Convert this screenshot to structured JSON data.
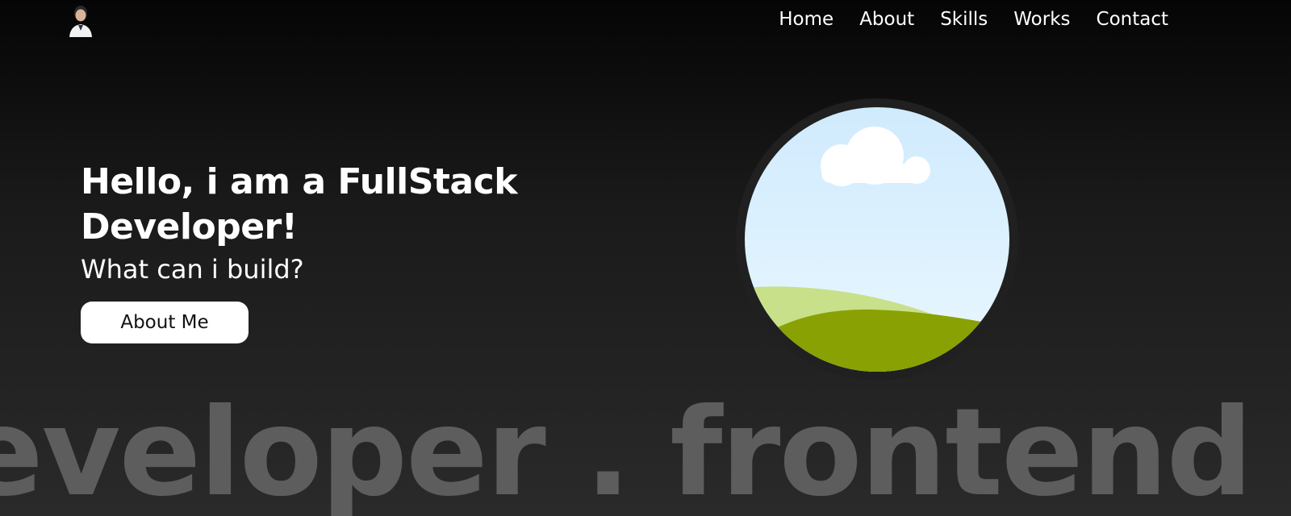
{
  "header": {
    "avatar_icon": "profile-avatar",
    "nav": [
      {
        "label": "Home"
      },
      {
        "label": "About"
      },
      {
        "label": "Skills"
      },
      {
        "label": "Works"
      },
      {
        "label": "Contact"
      }
    ]
  },
  "hero": {
    "title": "Hello, i am a FullStack Developer!",
    "subtitle": "What can i build?",
    "button_label": "About Me",
    "image_icon": "landscape-illustration"
  },
  "marquee": {
    "text": "eveloper . frontend . d"
  },
  "colors": {
    "background_top": "#050505",
    "background_bottom": "#2a2a2a",
    "text": "#ffffff",
    "button_bg": "#ffffff",
    "button_text": "#111111",
    "marquee_text": "#5d5d5d",
    "sky": "#d6efff",
    "hill_light": "#c8e08a",
    "hill_dark": "#89a103",
    "circle_border": "#202020"
  }
}
